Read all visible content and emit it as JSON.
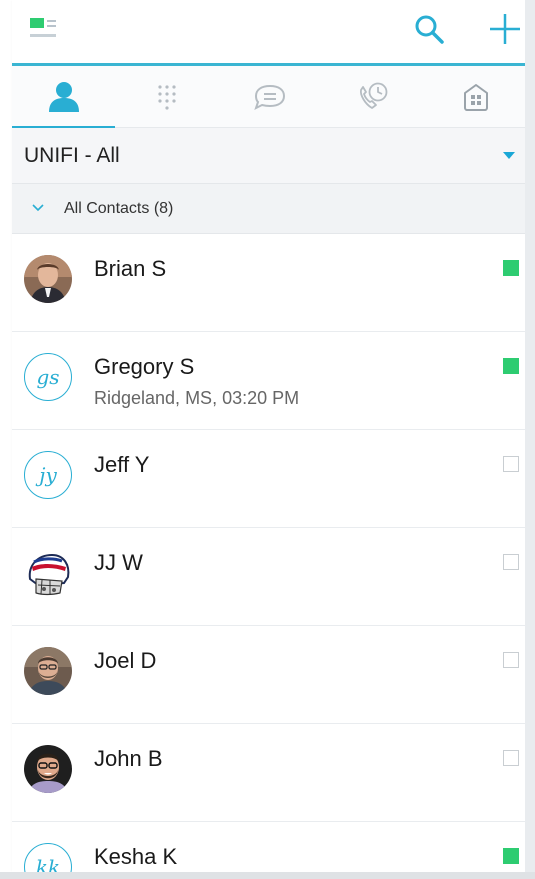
{
  "toolbar": {
    "menu_icon": "menu-icon",
    "search_icon": "search-icon",
    "add_icon": "plus-icon"
  },
  "tabs": [
    {
      "id": "contacts",
      "icon": "person-icon",
      "active": true
    },
    {
      "id": "dialpad",
      "icon": "dialpad-icon",
      "active": false
    },
    {
      "id": "chat",
      "icon": "chat-bubble-icon",
      "active": false
    },
    {
      "id": "history",
      "icon": "phone-clock-icon",
      "active": false
    },
    {
      "id": "directory",
      "icon": "building-icon",
      "active": false
    }
  ],
  "group_selector": {
    "label": "UNIFI - All"
  },
  "section": {
    "title": "All Contacts (8)"
  },
  "contacts": [
    {
      "name": "Brian S",
      "subtitle": "",
      "avatar": "photo",
      "initials": "",
      "online": true
    },
    {
      "name": "Gregory S",
      "subtitle": "Ridgeland, MS, 03:20 PM",
      "avatar": "initials",
      "initials": "gs",
      "online": true
    },
    {
      "name": "Jeff Y",
      "subtitle": "",
      "avatar": "initials",
      "initials": "jy",
      "online": false
    },
    {
      "name": "JJ W",
      "subtitle": "",
      "avatar": "helmet",
      "initials": "",
      "online": false
    },
    {
      "name": "Joel D",
      "subtitle": "",
      "avatar": "photo",
      "initials": "",
      "online": false
    },
    {
      "name": "John B",
      "subtitle": "",
      "avatar": "photo",
      "initials": "",
      "online": false
    },
    {
      "name": "Kesha K",
      "subtitle": "",
      "avatar": "initials",
      "initials": "kk",
      "online": true
    }
  ],
  "colors": {
    "accent": "#29aed3",
    "online": "#2ecc71",
    "offline_border": "#c9ced2"
  }
}
